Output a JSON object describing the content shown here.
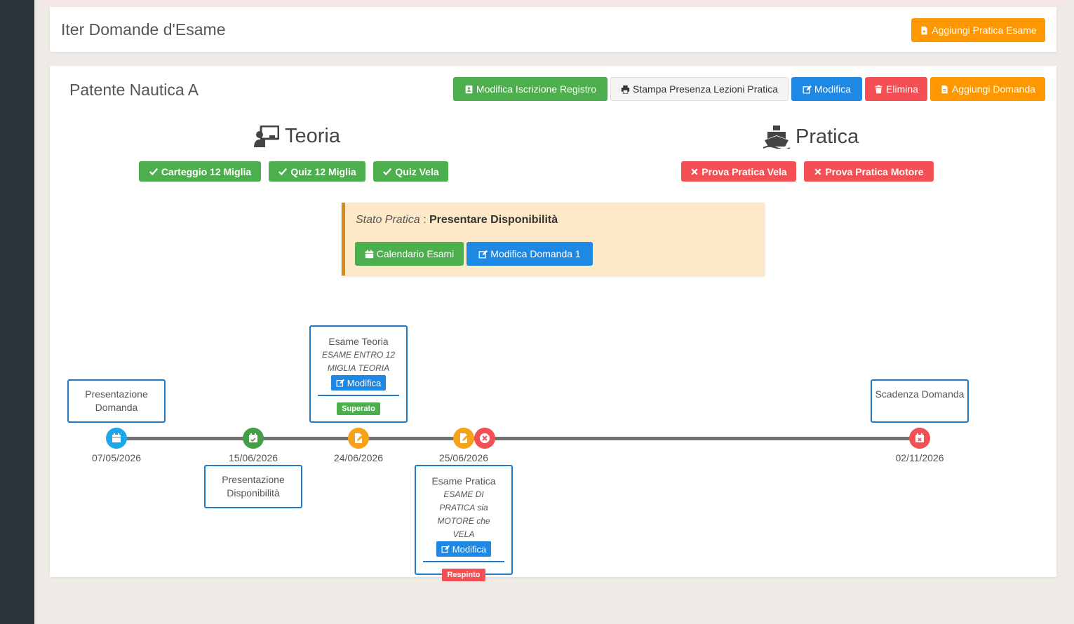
{
  "header": {
    "title": "Iter Domande d'Esame",
    "add_button": "Aggiungi Pratica Esame"
  },
  "pratica": {
    "title": "Patente Nautica A",
    "buttons": {
      "modifica_iscrizione": "Modifica Iscrizione Registro",
      "stampa_presenza": "Stampa Presenza Lezioni Pratica",
      "modifica": "Modifica",
      "elimina": "Elimina",
      "aggiungi_domanda": "Aggiungi Domanda"
    }
  },
  "teoria": {
    "title": "Teoria",
    "items": [
      "Carteggio 12 Miglia",
      "Quiz 12 Miglia",
      "Quiz Vela"
    ]
  },
  "pratica_section": {
    "title": "Pratica",
    "items": [
      "Prova Pratica Vela",
      "Prova Pratica Motore"
    ]
  },
  "stato": {
    "label": "Stato Pratica",
    "separator": ":",
    "value": "Presentare Disponibilità",
    "calendario": "Calendario Esami",
    "modifica_domanda": "Modifica Domanda 1"
  },
  "timeline": {
    "presentazione_domanda": {
      "title": "Presentazione Domanda",
      "date": "07/05/2026"
    },
    "presentazione_disponibilita": {
      "title": "Presentazione Disponibilità",
      "date": "15/06/2026"
    },
    "esame_teoria": {
      "title": "Esame Teoria",
      "subtitle": "ESAME ENTRO 12 MIGLIA TEORIA",
      "edit": "Modifica",
      "status": "Superato",
      "date": "24/06/2026"
    },
    "esame_pratica": {
      "title": "Esame Pratica",
      "subtitle": "ESAME DI PRATICA sia MOTORE che VELA",
      "edit": "Modifica",
      "status": "Respinto",
      "date": "25/06/2026"
    },
    "scadenza": {
      "title": "Scadenza Domanda",
      "date": "02/11/2026"
    }
  },
  "colors": {
    "green": "#4cae4c",
    "blue": "#1e88e5",
    "red": "#f44f55",
    "orange": "#ff9800",
    "node_blue": "#1ea7e8",
    "node_green": "#43a047",
    "node_orange": "#f7a21b",
    "node_red": "#f44f55"
  },
  "icons": {
    "add_pratica": "file-plus-icon",
    "modifica_iscrizione": "id-card-icon",
    "stampa": "print-icon",
    "modifica": "edit-icon",
    "elimina": "trash-icon",
    "aggiungi_domanda": "file-icon",
    "teoria": "chalkboard-teacher-icon",
    "pratica": "ship-icon",
    "check": "check-icon",
    "times": "times-icon",
    "calendario": "calendar-icon"
  }
}
